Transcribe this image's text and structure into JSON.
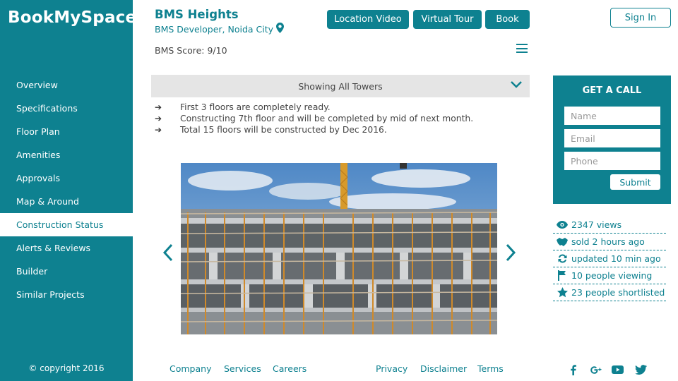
{
  "brand": {
    "logo": "BookMySpace"
  },
  "sidebar": {
    "items": [
      {
        "label": "Overview"
      },
      {
        "label": "Specifications"
      },
      {
        "label": "Floor Plan"
      },
      {
        "label": "Amenities"
      },
      {
        "label": "Approvals"
      },
      {
        "label": "Map & Around"
      },
      {
        "label": "Construction Status",
        "active": true
      },
      {
        "label": "Alerts & Reviews"
      },
      {
        "label": "Builder"
      },
      {
        "label": "Similar Projects"
      }
    ],
    "copyright": "© copyright 2016"
  },
  "header": {
    "title": "BMS Heights",
    "developer": "BMS Developer, Noida City",
    "score": "BMS Score: 9/10",
    "buttons": {
      "location_video": "Location Video",
      "virtual_tour": "Virtual Tour",
      "book": "Book"
    },
    "sign_in": "Sign In"
  },
  "towers": {
    "selected": "Showing All Towers"
  },
  "status_updates": [
    "First 3 floors are completely ready.",
    "Constructing 7th floor and will be completed by mid of next month.",
    "Total 15 floors will be constructed by Dec 2016."
  ],
  "call_form": {
    "title": "GET A CALL",
    "name_placeholder": "Name",
    "email_placeholder": "Email",
    "phone_placeholder": "Phone",
    "submit": "Submit"
  },
  "stats": [
    {
      "icon": "eye-icon",
      "text": "2347 views"
    },
    {
      "icon": "handshake-icon",
      "text": "sold 2 hours ago"
    },
    {
      "icon": "refresh-icon",
      "text": "updated 10 min ago"
    },
    {
      "icon": "flag-icon",
      "text": "10 people viewing"
    },
    {
      "icon": "star-icon",
      "text": "23 people shortlisted"
    }
  ],
  "footer": {
    "company": "Company",
    "services": "Services",
    "careers": "Careers",
    "privacy": "Privacy",
    "disclaimer": "Disclaimer",
    "terms": "Terms"
  },
  "colors": {
    "accent": "#0e8190",
    "bar": "#e5e5e5"
  }
}
